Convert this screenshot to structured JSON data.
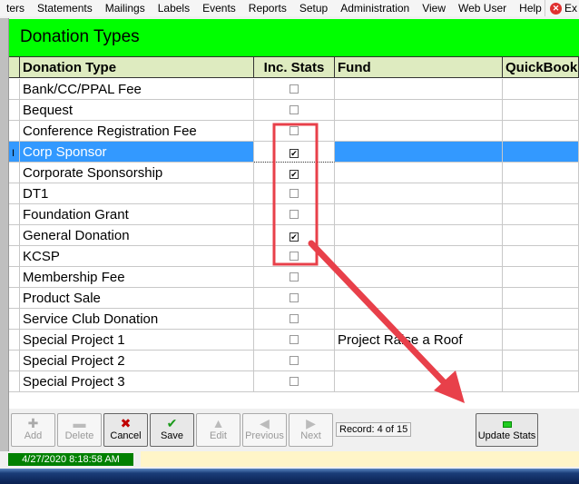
{
  "menu": [
    "ters",
    "Statements",
    "Mailings",
    "Labels",
    "Events",
    "Reports",
    "Setup",
    "Administration",
    "View",
    "Web User",
    "Help"
  ],
  "exit_label": "Ex",
  "title": "Donation Types",
  "columns": [
    "Donation Type",
    "Inc. Stats",
    "Fund",
    "QuickBook"
  ],
  "rows": [
    {
      "type": "Bank/CC/PPAL Fee",
      "inc": false,
      "fund": ""
    },
    {
      "type": "Bequest",
      "inc": false,
      "fund": ""
    },
    {
      "type": "Conference Registration Fee",
      "inc": false,
      "fund": ""
    },
    {
      "type": "Corp Sponsor",
      "inc": true,
      "fund": "",
      "selected": true
    },
    {
      "type": "Corporate Sponsorship",
      "inc": true,
      "fund": ""
    },
    {
      "type": "DT1",
      "inc": false,
      "fund": ""
    },
    {
      "type": "Foundation Grant",
      "inc": false,
      "fund": ""
    },
    {
      "type": "General Donation",
      "inc": true,
      "fund": ""
    },
    {
      "type": "KCSP",
      "inc": false,
      "fund": ""
    },
    {
      "type": "Membership Fee",
      "inc": false,
      "fund": ""
    },
    {
      "type": "Product Sale",
      "inc": false,
      "fund": ""
    },
    {
      "type": "Service Club Donation",
      "inc": false,
      "fund": ""
    },
    {
      "type": "Special Project 1",
      "inc": false,
      "fund": "Project Raise a Roof"
    },
    {
      "type": "Special Project 2",
      "inc": false,
      "fund": ""
    },
    {
      "type": "Special Project 3",
      "inc": false,
      "fund": ""
    }
  ],
  "toolbar": {
    "buttons": [
      {
        "label": "Add",
        "icon": "plus-icon",
        "enabled": false
      },
      {
        "label": "Delete",
        "icon": "minus-icon",
        "enabled": false
      },
      {
        "label": "Cancel",
        "icon": "x-icon",
        "enabled": true
      },
      {
        "label": "Save",
        "icon": "checkmark-icon",
        "enabled": true
      },
      {
        "label": "Edit",
        "icon": "up-arrow-icon",
        "enabled": false
      },
      {
        "label": "Previous",
        "icon": "left-arrow-icon",
        "enabled": false
      },
      {
        "label": "Next",
        "icon": "right-arrow-icon",
        "enabled": false
      }
    ],
    "record": "Record: 4 of 15",
    "update_stats": "Update Stats"
  },
  "status": {
    "datetime": "4/27/2020 8:18:58 AM"
  },
  "colors": {
    "title_bg": "#00ff00",
    "selected_row": "#3399ff",
    "annotation": "#e8404a"
  }
}
